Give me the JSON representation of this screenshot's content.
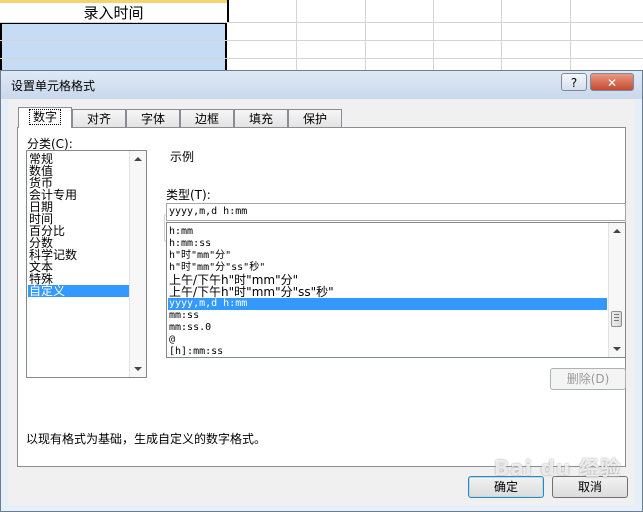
{
  "sheet": {
    "header_cell": "录入时间"
  },
  "dialog": {
    "title": "设置单元格格式",
    "help_label": "?",
    "close_label": "✕",
    "tabs": [
      "数字",
      "对齐",
      "字体",
      "边框",
      "填充",
      "保护"
    ],
    "category_label": "分类(C):",
    "categories": [
      "常规",
      "数值",
      "货币",
      "会计专用",
      "日期",
      "时间",
      "百分比",
      "分数",
      "科学记数",
      "文本",
      "特殊",
      "自定义"
    ],
    "selected_category": "自定义",
    "sample_label": "示例",
    "type_label": "类型(T):",
    "type_value": "yyyy,m,d h:mm",
    "type_list": [
      "h:mm",
      "h:mm:ss",
      "h\"时\"mm\"分\"",
      "h\"时\"mm\"分\"ss\"秒\"",
      "上午/下午h\"时\"mm\"分\"",
      "上午/下午h\"时\"mm\"分\"ss\"秒\"",
      "yyyy,m,d h:mm",
      "mm:ss",
      "mm:ss.0",
      "@",
      "[h]:mm:ss"
    ],
    "selected_type": "yyyy,m,d h:mm",
    "delete_button": "删除(D)",
    "description": "以现有格式为基础，生成自定义的数字格式。",
    "ok_button": "确定",
    "cancel_button": "取消"
  },
  "watermark": "Bai du 经验",
  "colors": {
    "selection": "#3399ff",
    "cell_selection": "#c6dcf5",
    "title_bar": "#c9d8ec"
  }
}
